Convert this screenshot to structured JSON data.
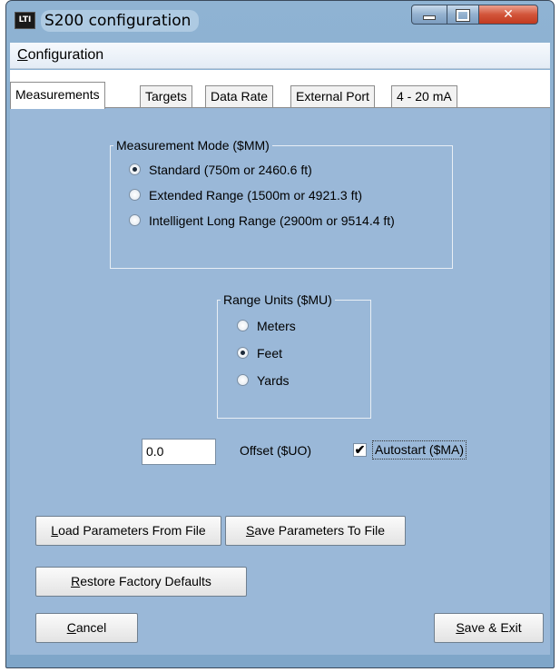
{
  "window": {
    "icon_text": "LTI",
    "title": "S200 configuration",
    "close_glyph": "✕"
  },
  "menu": {
    "items": [
      {
        "accel": "C",
        "rest": "onfiguration"
      }
    ]
  },
  "tabs": [
    {
      "label": "Measurements",
      "active": true
    },
    {
      "label": "Targets",
      "active": false
    },
    {
      "label": "Data Rate",
      "active": false
    },
    {
      "label": "External Port",
      "active": false
    },
    {
      "label": "4 - 20 mA",
      "active": false
    }
  ],
  "measurement_mode": {
    "title": "Measurement Mode ($MM)",
    "options": [
      {
        "label": "Standard (750m or 2460.6 ft)",
        "checked": true
      },
      {
        "label": "Extended Range (1500m or 4921.3 ft)",
        "checked": false
      },
      {
        "label": "Intelligent Long Range (2900m or 9514.4 ft)",
        "checked": false
      }
    ]
  },
  "range_units": {
    "title": "Range Units ($MU)",
    "options": [
      {
        "label": "Meters",
        "checked": false
      },
      {
        "label": "Feet",
        "checked": true
      },
      {
        "label": "Yards",
        "checked": false
      }
    ]
  },
  "offset": {
    "value": "0.0",
    "label": "Offset ($UO)"
  },
  "autostart": {
    "label": "Autostart ($MA)",
    "checked": true,
    "check_glyph": "✔"
  },
  "buttons": {
    "load": {
      "accel": "L",
      "rest": "oad Parameters From File"
    },
    "save_params": {
      "accel": "S",
      "rest": "ave Parameters To File"
    },
    "restore": {
      "accel": "R",
      "rest": "estore Factory Defaults"
    },
    "cancel": {
      "accel": "C",
      "rest": "ancel"
    },
    "save_exit": {
      "accel": "S",
      "rest": "ave & Exit"
    }
  },
  "colors": {
    "panel": "#9ab8d8",
    "frame": "#8fb3d3",
    "close_button": "#d2553a"
  }
}
